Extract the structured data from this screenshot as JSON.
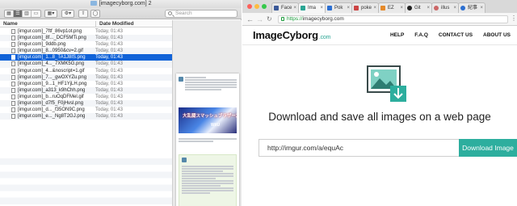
{
  "finder": {
    "title": "[imagecyborg.com] 2",
    "search_placeholder": "Search",
    "columns": {
      "name": "Name",
      "date": "Date Modified"
    },
    "files": [
      {
        "name": "[imgur.com]_7ftf_86vp1ot.png",
        "date": "Today, 01:43"
      },
      {
        "name": "[imgur.com]_8f..._DCF5MTi.png",
        "date": "Today, 01:43"
      },
      {
        "name": "[imgur.com]_9ddb.png",
        "date": "Today, 01:43"
      },
      {
        "name": "[imgur.com]_8...0950&cv=2.gif",
        "date": "Today, 01:43"
      },
      {
        "name": "[imgur.com]_1...8_TA1J8IS.png",
        "date": "Today, 01:43",
        "selected": true
      },
      {
        "name": "[imgur.com]_4..._7XMK5G.png",
        "date": "Today, 01:43"
      },
      {
        "name": "[imgur.com]_4...&noscript=1.gif",
        "date": "Today, 01:43"
      },
      {
        "name": "[imgur.com]_7..._gwOXYZu.png",
        "date": "Today, 01:43"
      },
      {
        "name": "[imgur.com]_9...1_HF1YjLH.png",
        "date": "Today, 01:43"
      },
      {
        "name": "[imgur.com]_a313_k9hChh.png",
        "date": "Today, 01:43"
      },
      {
        "name": "[imgur.com]_b...ruOqDFMel.gif",
        "date": "Today, 01:43"
      },
      {
        "name": "[imgur.com]_d7f5_F0jHvsl.png",
        "date": "Today, 01:43"
      },
      {
        "name": "[imgur.com]_d..._f35ON9C.png",
        "date": "Today, 01:43"
      },
      {
        "name": "[imgur.com]_e..._Ng8T2GJ.png",
        "date": "Today, 01:43"
      }
    ],
    "preview": {
      "logo_text": "大乱闘スマッシュブラザーズ",
      "wiiu": "WiiU"
    }
  },
  "browser": {
    "tabs": [
      {
        "label": "Face",
        "color": "#3b5998"
      },
      {
        "label": "Ima",
        "color": "#2aa594",
        "active": true
      },
      {
        "label": "Pok",
        "color": "#2b6fd1"
      },
      {
        "label": "poke",
        "color": "#c44"
      },
      {
        "label": "EZ",
        "color": "#e58a2a"
      },
      {
        "label": "Git",
        "color": "#222"
      },
      {
        "label": "illus",
        "color": "#c66"
      },
      {
        "label": "紀事",
        "color": "#2b6fd1"
      }
    ],
    "url_scheme": "https://",
    "url_rest": "imagecyborg.com"
  },
  "site": {
    "brand": "ImageCyborg",
    "brand_suffix": ".com",
    "nav": [
      "HELP",
      "F.A.Q",
      "CONTACT US",
      "ABOUT US"
    ],
    "headline": "Download and save all images on a web page",
    "input_value": "http://imgur.com/a/equAc",
    "button_label": "Download Image",
    "accent_color": "#2dae9e"
  }
}
